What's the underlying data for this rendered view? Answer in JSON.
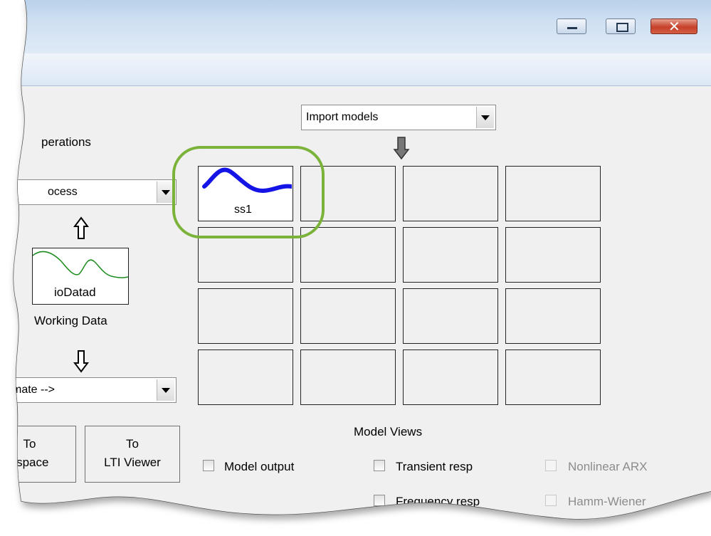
{
  "operations": {
    "title": "perations",
    "process_select": "ocess",
    "estimate_select": "timate -->"
  },
  "working_data": {
    "name": "ioDatad",
    "caption": "Working Data"
  },
  "import_models": {
    "selected": "Import models"
  },
  "model_board": {
    "models": [
      {
        "name": "ss1",
        "color": "#1414e6"
      }
    ],
    "highlight_color": "#7bb33a"
  },
  "buttons": {
    "to_workspace": {
      "line1": "To",
      "line2": "kspace"
    },
    "to_lti_viewer": {
      "line1": "To",
      "line2": "LTI Viewer"
    }
  },
  "model_views": {
    "title": "Model Views",
    "checks": [
      {
        "label": "Model output",
        "enabled": true
      },
      {
        "label": "Transient resp",
        "enabled": true
      },
      {
        "label": "Nonlinear ARX",
        "enabled": false
      },
      {
        "label": "Frequency resp",
        "enabled": true
      },
      {
        "label": "Hamm-Wiener",
        "enabled": false
      }
    ]
  }
}
